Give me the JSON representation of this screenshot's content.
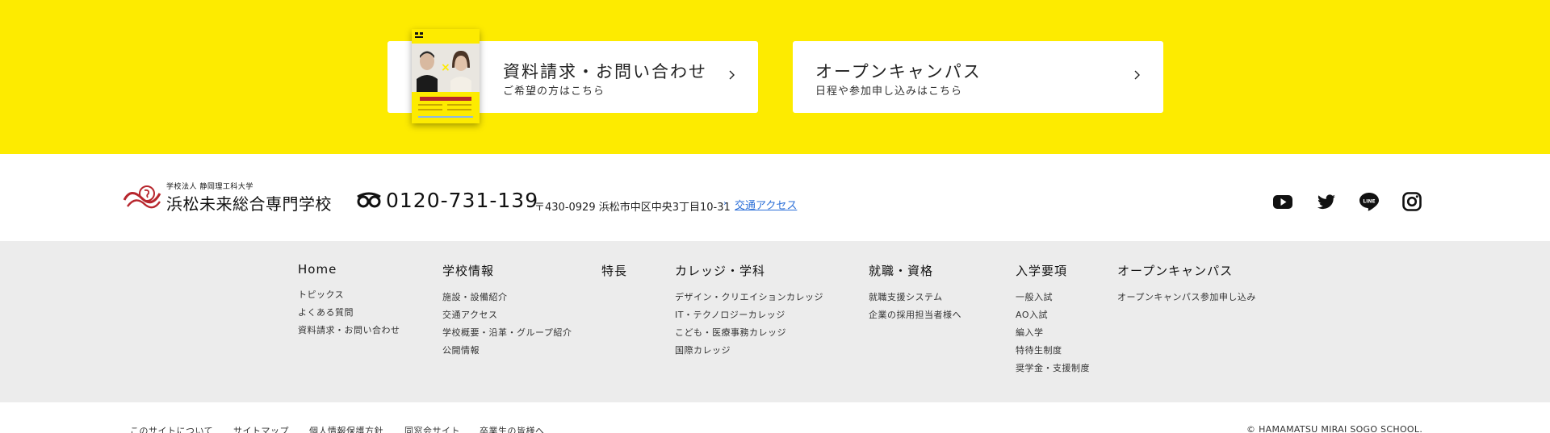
{
  "cta": {
    "brochure": {
      "title": "資料請求・お問い合わせ",
      "subtitle": "ご希望の方はこちら",
      "chevron_icon": "chevron-right-icon"
    },
    "open_campus": {
      "title": "オープンキャンパス",
      "subtitle": "日程や参加申し込みはこちら",
      "chevron_icon": "chevron-right-icon"
    }
  },
  "info": {
    "logo_small": "学校法人 静岡理工科大学",
    "logo_big": "浜松未来総合専門学校",
    "free_dial_icon": "free-dial-icon",
    "phone": "0120-731-139",
    "address": "〒430-0929 浜松市中区中央3丁目10-31",
    "access_link": "交通アクセス",
    "social": [
      "youtube-icon",
      "twitter-icon",
      "line-icon",
      "instagram-icon"
    ]
  },
  "sitemap": {
    "columns": [
      {
        "head": "Home",
        "links": [
          "トピックス",
          "よくある質問",
          "資料請求・お問い合わせ"
        ]
      },
      {
        "head": "学校情報",
        "links": [
          "施設・設備紹介",
          "交通アクセス",
          "学校概要・沿革・グループ紹介",
          "公開情報"
        ]
      },
      {
        "head": "特長",
        "links": []
      },
      {
        "head": "カレッジ・学科",
        "links": [
          "デザイン・クリエイションカレッジ",
          "IT・テクノロジーカレッジ",
          "こども・医療事務カレッジ",
          "国際カレッジ"
        ]
      },
      {
        "head": "就職・資格",
        "links": [
          "就職支援システム",
          "企業の採用担当者様へ"
        ]
      },
      {
        "head": "入学要項",
        "links": [
          "一般入試",
          "AO入試",
          "編入学",
          "特待生制度",
          "奨学金・支援制度"
        ]
      },
      {
        "head": "オープンキャンパス",
        "links": [
          "オープンキャンパス参加申し込み"
        ]
      }
    ]
  },
  "bottom": {
    "links": [
      "このサイトについて",
      "サイトマップ",
      "個人情報保護方針",
      "同窓会サイト",
      "卒業生の皆様へ"
    ],
    "copyright": "© HAMAMATSU MIRAI SOGO SCHOOL."
  },
  "colors": {
    "band_yellow": "#fdeb00",
    "sitemap_gray": "#ececec",
    "brand_red": "#b7262d",
    "link_blue": "#2b6fd8"
  }
}
